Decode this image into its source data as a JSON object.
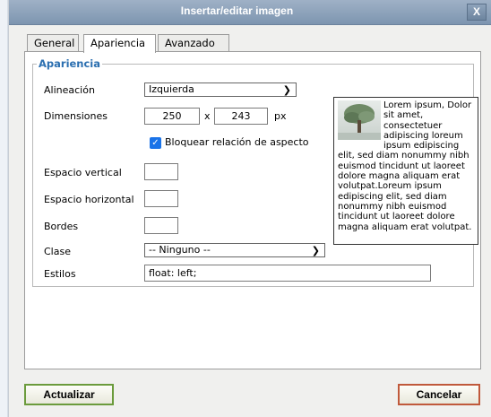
{
  "dialog": {
    "title": "Insertar/editar imagen",
    "close_label": "X"
  },
  "tabs": [
    {
      "label": "General",
      "active": false
    },
    {
      "label": "Apariencia",
      "active": true
    },
    {
      "label": "Avanzado",
      "active": false
    }
  ],
  "appearance": {
    "legend": "Apariencia",
    "alignment": {
      "label": "Alineación",
      "value": "Izquierda"
    },
    "dimensions": {
      "label": "Dimensiones",
      "width": "250",
      "separator": "x",
      "height": "243",
      "unit": "px"
    },
    "constrain": {
      "label": "Bloquear relación de aspecto",
      "checked": true
    },
    "vspace": {
      "label": "Espacio vertical",
      "value": ""
    },
    "hspace": {
      "label": "Espacio horizontal",
      "value": ""
    },
    "border": {
      "label": "Bordes",
      "value": ""
    },
    "class": {
      "label": "Clase",
      "value": "-- Ninguno --"
    },
    "style": {
      "label": "Estilos",
      "value": "float: left;"
    },
    "preview_text": "Lorem ipsum, Dolor sit amet, consectetuer adipiscing loreum ipsum edipiscing elit, sed diam nonummy nibh euismod tincidunt ut laoreet dolore magna aliquam erat volutpat.Loreum ipsum edipiscing elit, sed diam nonummy nibh euismod tincidunt ut laoreet dolore magna aliquam erat volutpat."
  },
  "buttons": {
    "update": "Actualizar",
    "cancel": "Cancelar"
  },
  "colors": {
    "legend": "#2b6fb0",
    "checkbox": "#1a73e8",
    "update_border": "#6b9b3c",
    "cancel_border": "#c0593b"
  }
}
